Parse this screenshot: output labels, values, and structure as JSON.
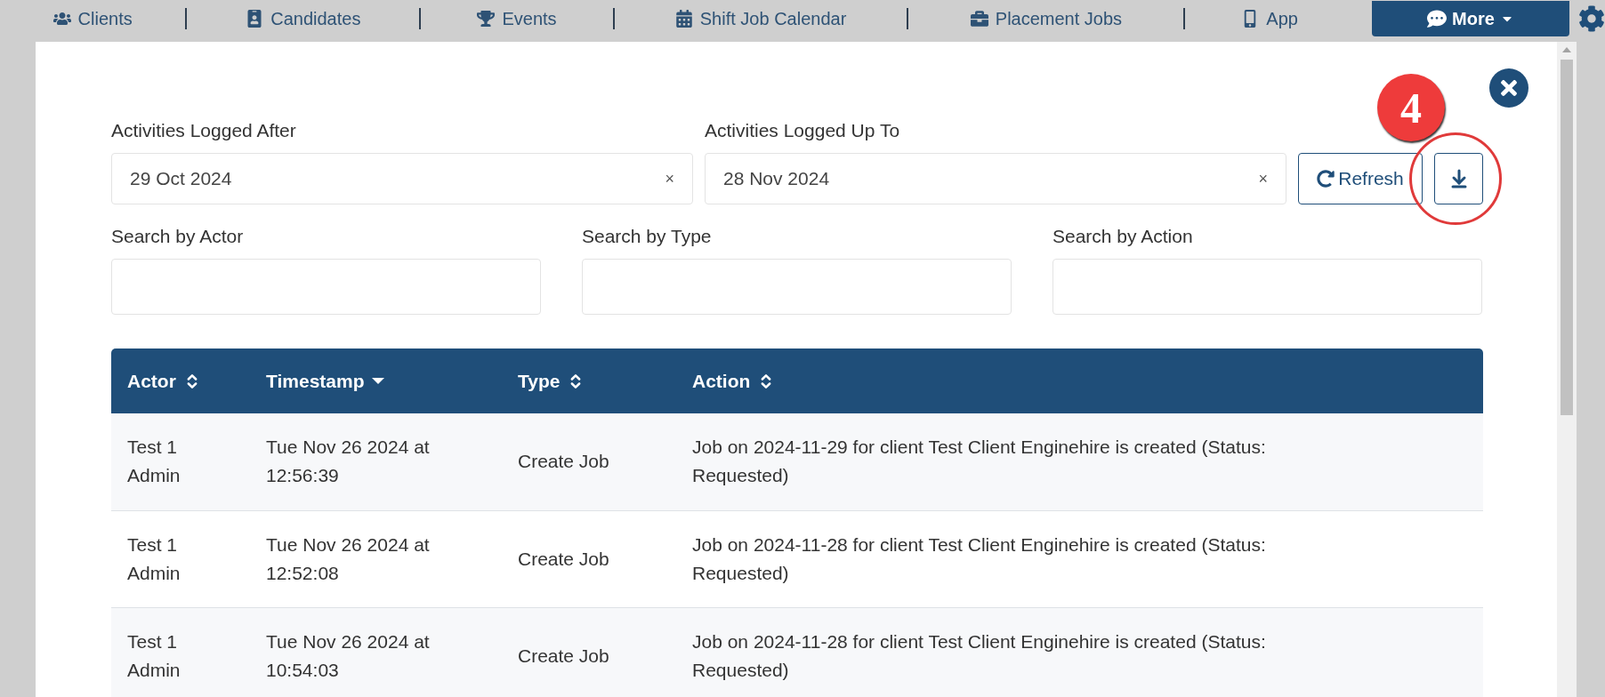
{
  "nav": {
    "items": [
      {
        "label": "Clients"
      },
      {
        "label": "Candidates"
      },
      {
        "label": "Events"
      },
      {
        "label": "Shift Job Calendar"
      },
      {
        "label": "Placement Jobs"
      },
      {
        "label": "App"
      }
    ],
    "more": "More"
  },
  "filters": {
    "dates": [
      {
        "label": "Activities Logged After",
        "value": "29 Oct 2024",
        "clear": "×"
      },
      {
        "label": "Activities Logged Up To",
        "value": "28 Nov 2024",
        "clear": "×"
      }
    ],
    "refresh": "Refresh",
    "searches": [
      {
        "label": "Search by Actor"
      },
      {
        "label": "Search by Type"
      },
      {
        "label": "Search by Action"
      }
    ]
  },
  "annotation": {
    "badge": "4"
  },
  "table": {
    "columns": [
      {
        "label": "Actor",
        "sorted": false
      },
      {
        "label": "Timestamp",
        "sorted": true
      },
      {
        "label": "Type",
        "sorted": false
      },
      {
        "label": "Action",
        "sorted": false
      }
    ],
    "rows": [
      [
        "Test 1 Admin",
        "Tue Nov 26 2024 at 12:56:39",
        "Create Job",
        "Job on 2024-11-29 for client Test Client Enginehire is created (Status: Requested)"
      ],
      [
        "Test 1 Admin",
        "Tue Nov 26 2024 at 12:52:08",
        "Create Job",
        "Job on 2024-11-28 for client Test Client Enginehire is created (Status: Requested)"
      ],
      [
        "Test 1 Admin",
        "Tue Nov 26 2024 at 10:54:03",
        "Create Job",
        "Job on 2024-11-28 for client Test Client Enginehire is created (Status: Requested)"
      ]
    ]
  }
}
